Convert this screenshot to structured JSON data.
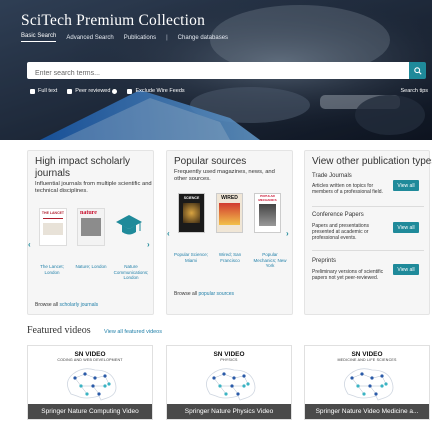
{
  "brand": "SciTech Premium Collection",
  "nav": {
    "basic_search": "Basic Search",
    "advanced_search": "Advanced Search",
    "publications": "Publications",
    "separator": "|",
    "change_databases": "Change databases"
  },
  "search": {
    "placeholder": "Enter search terms...",
    "full_text": "Full text",
    "peer_reviewed": "Peer reviewed",
    "exclude_wire": "Exclude Wire Feeds",
    "tips": "Search tips"
  },
  "journals": {
    "title": "High impact scholarly journals",
    "subtitle": "Influential journals from multiple scientific and technical disciplines.",
    "items": [
      {
        "cover": "THE LANCET",
        "caption": "The Lancet; London"
      },
      {
        "cover": "nature",
        "caption": "Nature; London"
      },
      {
        "cover": "",
        "caption": "Nature Communications; London"
      }
    ],
    "browse_prefix": "Browse all",
    "browse_link": "scholarly journals"
  },
  "popular": {
    "title": "Popular sources",
    "subtitle": "Frequently used magazines, news, and other sources.",
    "items": [
      {
        "cover": "SCIENCE",
        "caption": "Popular Science; Miami"
      },
      {
        "cover": "WIRED",
        "caption": "Wired; San Francisco"
      },
      {
        "cover": "POPULAR MECHANICS",
        "caption": "Popular Mechanics; New York"
      }
    ],
    "browse_prefix": "Browse all",
    "browse_link": "popular sources"
  },
  "pubtypes": {
    "title": "View other publication types",
    "items": [
      {
        "title": "Trade Journals",
        "desc": "Articles written on topics for members of a professional field.",
        "button": "View all"
      },
      {
        "title": "Conference Papers",
        "desc": "Papers and presentations presented at academic or professional events.",
        "button": "View all"
      },
      {
        "title": "Preprints",
        "desc": "Preliminary versions of scientific papers not yet peer-reviewed.",
        "button": "View all"
      }
    ]
  },
  "featured": {
    "title": "Featured videos",
    "link": "View all featured videos",
    "videos": [
      {
        "brand": "SN VIDEO",
        "subject": "CODING AND WEB DEVELOPMENT",
        "caption": "Springer Nature Computing Video"
      },
      {
        "brand": "SN VIDEO",
        "subject": "PHYSICS",
        "caption": "Springer Nature Physics Video"
      },
      {
        "brand": "SN VIDEO",
        "subject": "MEDICINE AND LIFE SCIENCES",
        "caption": "Springer Nature Video Medicine a..."
      }
    ]
  },
  "icons": {
    "search": "search-icon",
    "prev": "chevron-left-icon",
    "next": "chevron-right-icon",
    "info": "info-icon",
    "cap": "graduation-cap-icon"
  },
  "colors": {
    "accent": "#1f8a9a",
    "link": "#1f7fa8"
  }
}
